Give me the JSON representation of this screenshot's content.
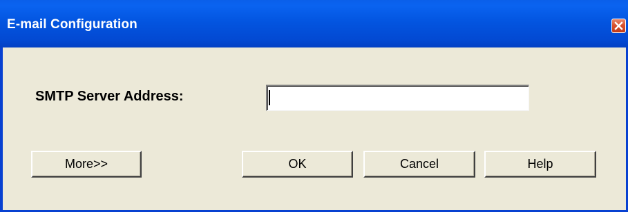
{
  "window": {
    "title": "E-mail Configuration",
    "close_icon": "close-icon"
  },
  "form": {
    "smtp_label": "SMTP Server Address:",
    "smtp_value": ""
  },
  "buttons": {
    "more_label": "More>>",
    "ok_label": "OK",
    "cancel_label": "Cancel",
    "help_label": "Help"
  },
  "colors": {
    "titlebar": "#0355e0",
    "dialog_background": "#ece9d8",
    "close_button": "#d9532f"
  }
}
